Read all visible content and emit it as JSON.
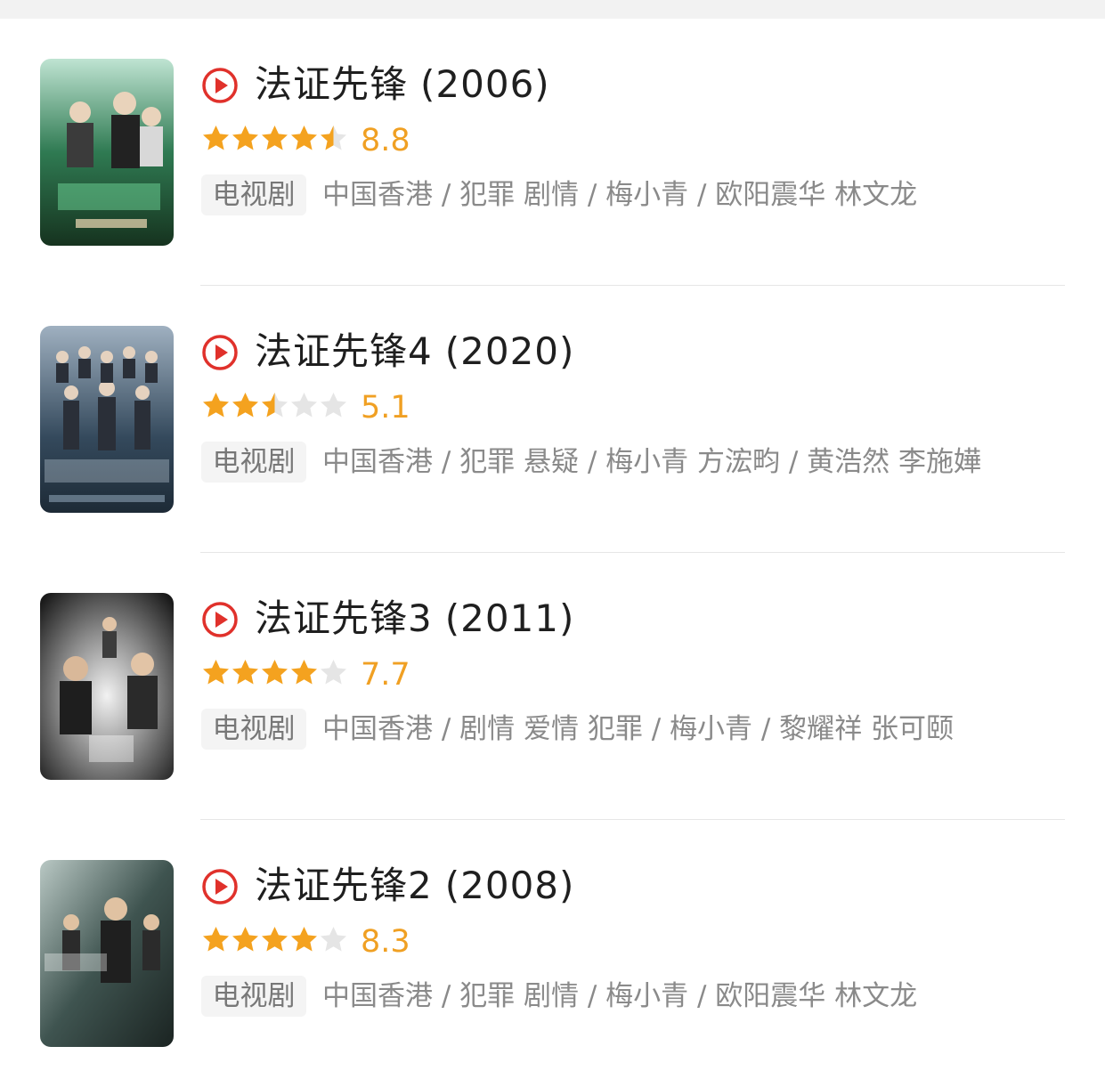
{
  "items": [
    {
      "title": "法证先锋",
      "year": "(2006)",
      "rating": "8.8",
      "stars": 4.5,
      "type": "电视剧",
      "meta": "中国香港 / 犯罪 剧情 / 梅小青 / 欧阳震华 林文龙",
      "poster_colors": {
        "bg": "#1f5a3a",
        "accent": "#6fd89a"
      }
    },
    {
      "title": "法证先锋4",
      "year": "(2020)",
      "rating": "5.1",
      "stars": 2.5,
      "type": "电视剧",
      "meta": "中国香港 / 犯罪 悬疑 / 梅小青 方浤畇 / 黄浩然 李施嬅",
      "poster_colors": {
        "bg": "#2b3a4a",
        "accent": "#c9d6e3"
      }
    },
    {
      "title": "法证先锋3",
      "year": "(2011)",
      "rating": "7.7",
      "stars": 4,
      "type": "电视剧",
      "meta": "中国香港 / 剧情 爱情 犯罪 / 梅小青 / 黎耀祥 张可颐",
      "poster_colors": {
        "bg": "#3a3a3a",
        "accent": "#e8e8e8"
      }
    },
    {
      "title": "法证先锋2",
      "year": "(2008)",
      "rating": "8.3",
      "stars": 4,
      "type": "电视剧",
      "meta": "中国香港 / 犯罪 剧情 / 梅小青 / 欧阳震华 林文龙",
      "poster_colors": {
        "bg": "#2e3d3a",
        "accent": "#b7c9c2"
      }
    }
  ],
  "colors": {
    "star_on": "#f4a21f",
    "star_off": "#e5e5e5",
    "rating_text": "#f0a023",
    "play_icon": "#e0312b"
  },
  "icons": {
    "play": "play-circle-icon",
    "star": "star-icon"
  }
}
